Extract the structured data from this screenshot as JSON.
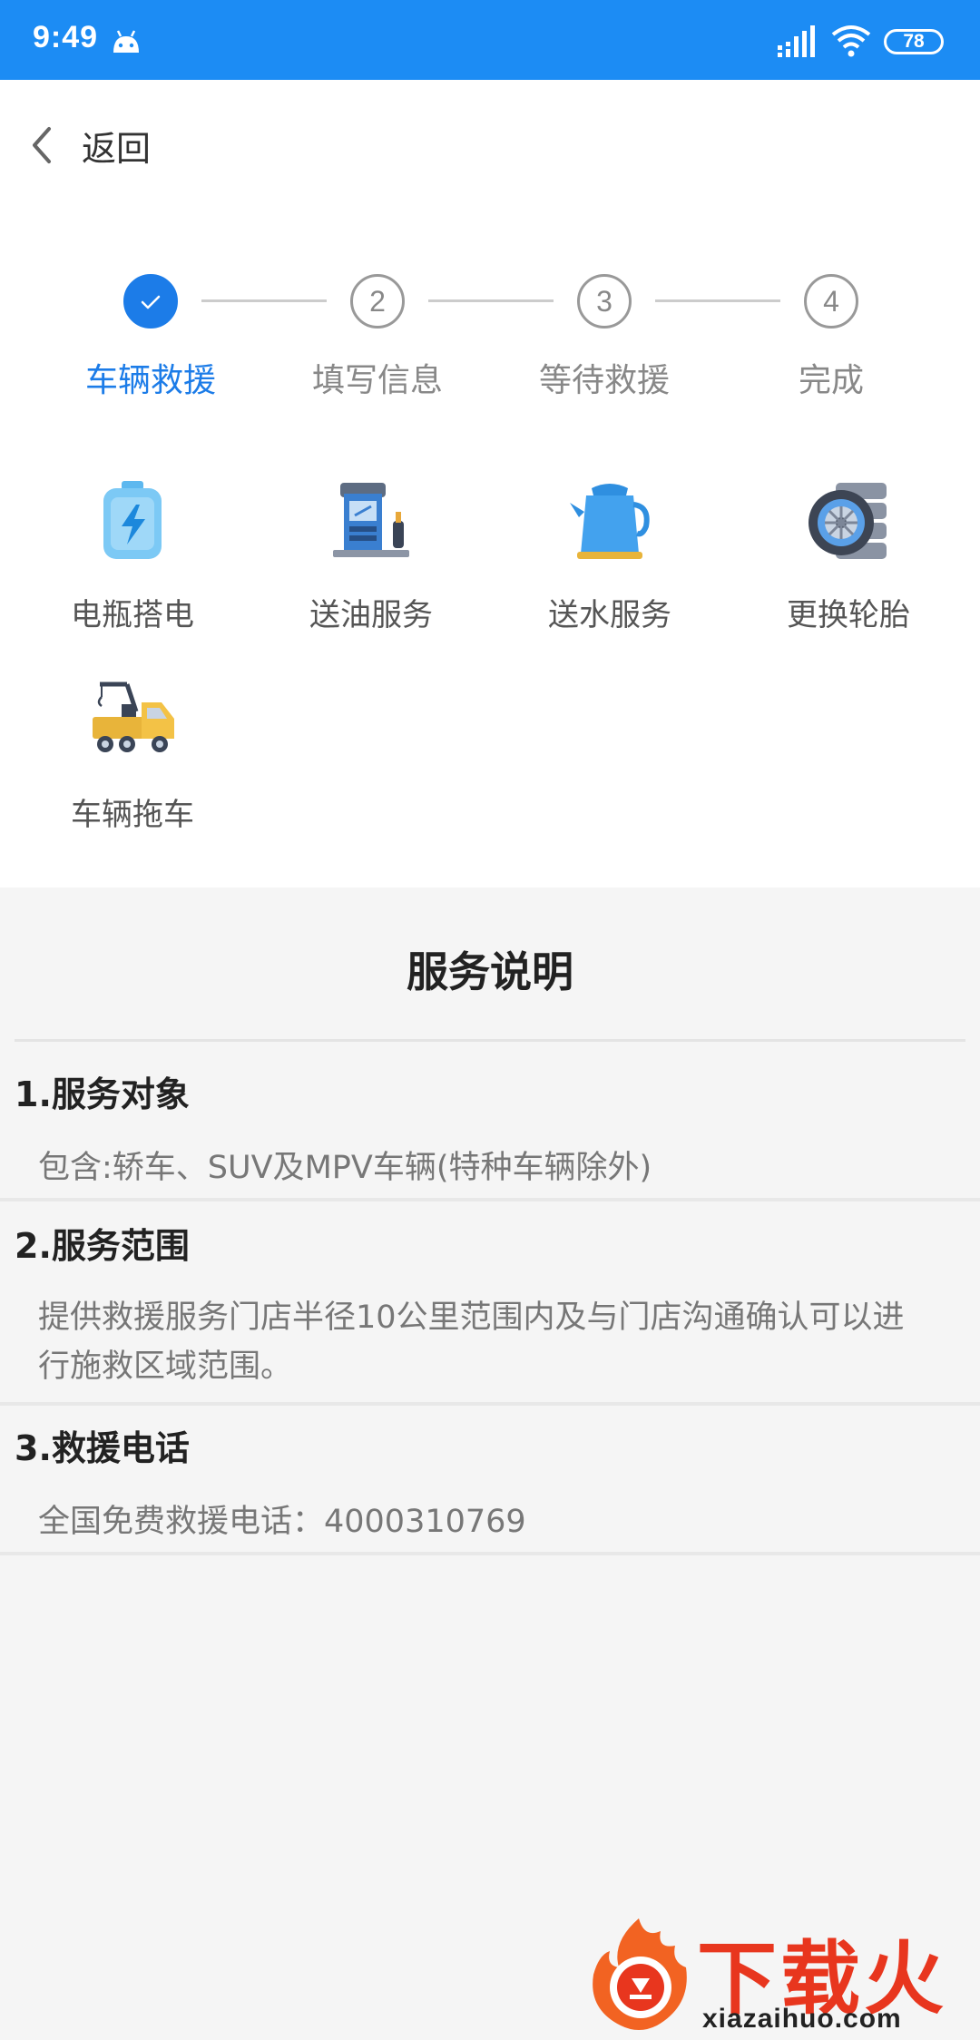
{
  "status_bar": {
    "time": "9:49",
    "battery": "78"
  },
  "nav": {
    "back_label": "返回"
  },
  "stepper": {
    "steps": [
      {
        "number": "",
        "label": "车辆救援",
        "state": "done"
      },
      {
        "number": "2",
        "label": "填写信息",
        "state": "pending"
      },
      {
        "number": "3",
        "label": "等待救援",
        "state": "pending"
      },
      {
        "number": "4",
        "label": "完成",
        "state": "pending"
      }
    ]
  },
  "services": [
    {
      "label": "电瓶搭电",
      "icon": "battery-charge-icon"
    },
    {
      "label": "送油服务",
      "icon": "fuel-pump-icon"
    },
    {
      "label": "送水服务",
      "icon": "water-kettle-icon"
    },
    {
      "label": "更换轮胎",
      "icon": "tire-icon"
    },
    {
      "label": "车辆拖车",
      "icon": "tow-truck-icon"
    }
  ],
  "description": {
    "title": "服务说明",
    "sections": [
      {
        "title": "1.服务对象",
        "body": "包含:轿车、SUV及MPV车辆(特种车辆除外)"
      },
      {
        "title": "2.服务范围",
        "body": "提供救援服务门店半径10公里范围内及与门店沟通确认可以进行施救区域范围。"
      },
      {
        "title": "3.救援电话",
        "body": "全国免费救援电话：4000310769"
      }
    ]
  },
  "watermark": {
    "brand": "下载火",
    "url": "xiazaihuo.com"
  },
  "colors": {
    "primary": "#1c8cf4",
    "active_step": "#1c7ce8",
    "watermark": "#e8361e"
  }
}
